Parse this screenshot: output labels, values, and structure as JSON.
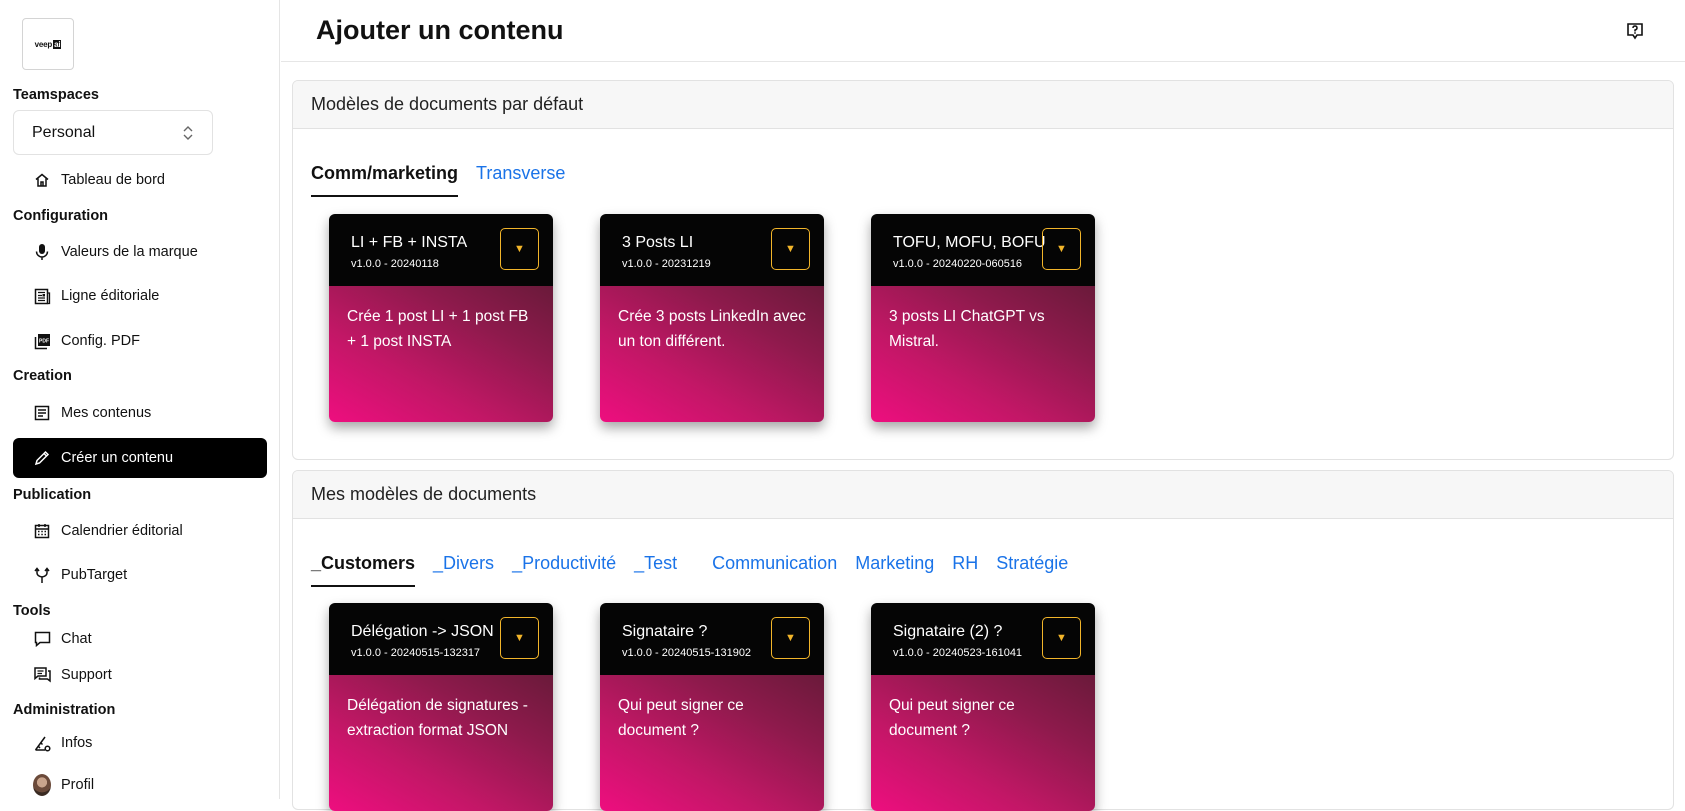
{
  "sidebar": {
    "logo": {
      "text": "veep",
      "badge": "ai"
    },
    "teamspaces_title": "Teamspaces",
    "teamspace_selected": "Personal",
    "dashboard": "Tableau de bord",
    "sections": {
      "configuration": "Configuration",
      "creation": "Creation",
      "publication": "Publication",
      "tools": "Tools",
      "administration": "Administration"
    },
    "items": {
      "brand_values": "Valeurs de la marque",
      "editorial_line": "Ligne éditoriale",
      "pdf_config": "Config. PDF",
      "my_contents": "Mes contenus",
      "create_content": "Créer un contenu",
      "editorial_calendar": "Calendrier éditorial",
      "pubtarget": "PubTarget",
      "chat": "Chat",
      "support": "Support",
      "infos": "Infos",
      "profile": "Profil"
    }
  },
  "main": {
    "title": "Ajouter un contenu",
    "default_panel": {
      "title": "Modèles de documents par défaut",
      "tabs": [
        "Comm/marketing",
        "Transverse"
      ],
      "cards": [
        {
          "title": "LI + FB + INSTA",
          "version": "v1.0.0 - 20240118",
          "description": "Crée 1 post LI + 1 post FB + 1 post INSTA"
        },
        {
          "title": "3 Posts LI",
          "version": "v1.0.0 - 20231219",
          "description": "Crée 3 posts LinkedIn avec un ton différent."
        },
        {
          "title": "TOFU, MOFU, BOFU",
          "version": "v1.0.0 - 20240220-060516",
          "description": "3 posts LI ChatGPT vs Mistral."
        }
      ]
    },
    "my_panel": {
      "title": "Mes modèles de documents",
      "tabs": [
        "_Customers",
        "_Divers",
        "_Productivité",
        "_Test",
        "Communication",
        "Marketing",
        "RH",
        "Stratégie"
      ],
      "cards": [
        {
          "title": "Délégation -> JSON",
          "version": "v1.0.0 - 20240515-132317",
          "description": "Délégation de signatures - extraction format JSON"
        },
        {
          "title": "Signataire ?",
          "version": "v1.0.0 - 20240515-131902",
          "description": "Qui peut signer ce document ?"
        },
        {
          "title": "Signataire (2) ?",
          "version": "v1.0.0 - 20240523-161041",
          "description": "Qui peut signer ce document ?"
        }
      ]
    }
  },
  "colors": {
    "accent_link": "#1a73e8",
    "menu_button": "#f2b52a",
    "card_gradient_start": "#ee0e7f",
    "card_gradient_end": "#6a1a3a"
  }
}
